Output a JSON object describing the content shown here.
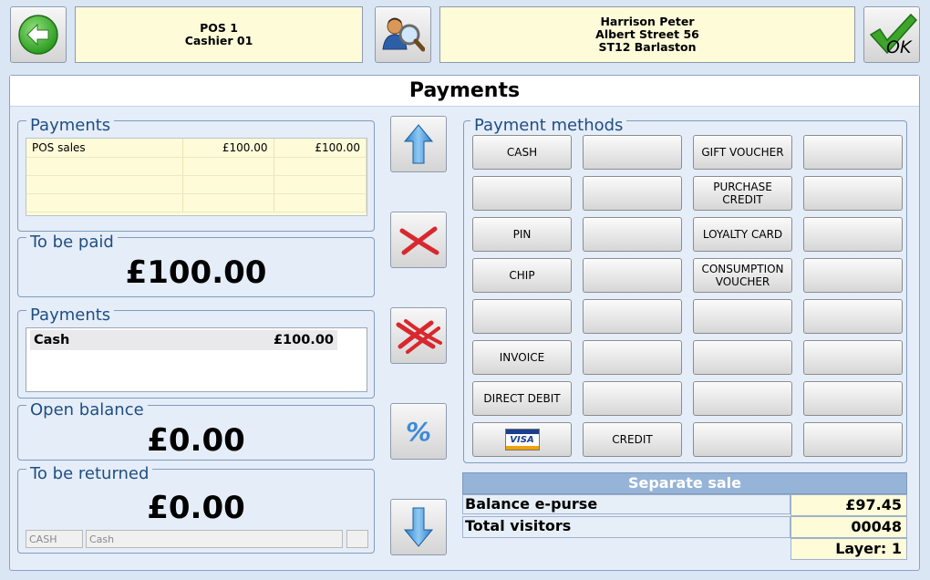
{
  "header": {
    "pos_line1": "POS 1",
    "pos_line2": "Cashier 01",
    "customer_line1": "Harrison  Peter",
    "customer_line2": "Albert Street 56",
    "customer_line3": "ST12 Barlaston",
    "ok_label": "OK"
  },
  "page_title": "Payments",
  "payments_top": {
    "legend": "Payments",
    "rows": [
      {
        "desc": "POS sales",
        "amount": "£100.00",
        "total": "£100.00"
      },
      {
        "desc": "",
        "amount": "",
        "total": ""
      },
      {
        "desc": "",
        "amount": "",
        "total": ""
      },
      {
        "desc": "",
        "amount": "",
        "total": ""
      }
    ]
  },
  "to_be_paid": {
    "legend": "To be paid",
    "amount": "£100.00"
  },
  "payments_list": {
    "legend": "Payments",
    "rows": [
      {
        "method": "Cash",
        "amount": "£100.00"
      }
    ]
  },
  "open_balance": {
    "legend": "Open balance",
    "amount": "£0.00"
  },
  "to_be_returned": {
    "legend": "To be returned",
    "amount": "£0.00",
    "field_code": "CASH",
    "field_name": "Cash"
  },
  "payment_methods": {
    "legend": "Payment methods",
    "col1": [
      "CASH",
      "",
      "PIN",
      "CHIP",
      "",
      "INVOICE",
      "DIRECT DEBIT",
      "VISA"
    ],
    "col2": [
      "",
      "",
      "",
      "",
      "",
      "",
      "",
      "CREDIT"
    ],
    "col3": [
      "GIFT VOUCHER",
      "PURCHASE CREDIT",
      "LOYALTY CARD",
      "CONSUMPTION VOUCHER",
      "",
      "",
      "",
      ""
    ],
    "col4": [
      "",
      "",
      "",
      "",
      "",
      "",
      "",
      ""
    ]
  },
  "separate_sale": {
    "title": "Separate sale",
    "balance_label": "Balance e-purse",
    "balance_value": "£97.45",
    "visitors_label": "Total visitors",
    "visitors_value": "00048",
    "layer_label": "Layer: 1"
  },
  "colors": {
    "accent_blue": "#1f4e84",
    "info_bg": "#fefbd9",
    "panel_bg": "#e5edf8"
  }
}
